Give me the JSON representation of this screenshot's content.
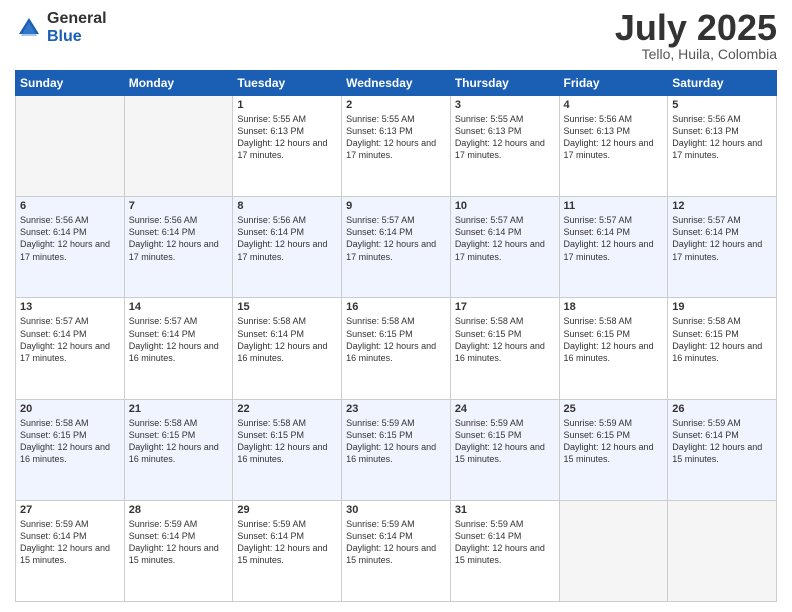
{
  "logo": {
    "general": "General",
    "blue": "Blue"
  },
  "header": {
    "title": "July 2025",
    "subtitle": "Tello, Huila, Colombia"
  },
  "weekdays": [
    "Sunday",
    "Monday",
    "Tuesday",
    "Wednesday",
    "Thursday",
    "Friday",
    "Saturday"
  ],
  "weeks": [
    [
      {
        "day": "",
        "info": ""
      },
      {
        "day": "",
        "info": ""
      },
      {
        "day": "1",
        "info": "Sunrise: 5:55 AM\nSunset: 6:13 PM\nDaylight: 12 hours and 17 minutes."
      },
      {
        "day": "2",
        "info": "Sunrise: 5:55 AM\nSunset: 6:13 PM\nDaylight: 12 hours and 17 minutes."
      },
      {
        "day": "3",
        "info": "Sunrise: 5:55 AM\nSunset: 6:13 PM\nDaylight: 12 hours and 17 minutes."
      },
      {
        "day": "4",
        "info": "Sunrise: 5:56 AM\nSunset: 6:13 PM\nDaylight: 12 hours and 17 minutes."
      },
      {
        "day": "5",
        "info": "Sunrise: 5:56 AM\nSunset: 6:13 PM\nDaylight: 12 hours and 17 minutes."
      }
    ],
    [
      {
        "day": "6",
        "info": "Sunrise: 5:56 AM\nSunset: 6:14 PM\nDaylight: 12 hours and 17 minutes."
      },
      {
        "day": "7",
        "info": "Sunrise: 5:56 AM\nSunset: 6:14 PM\nDaylight: 12 hours and 17 minutes."
      },
      {
        "day": "8",
        "info": "Sunrise: 5:56 AM\nSunset: 6:14 PM\nDaylight: 12 hours and 17 minutes."
      },
      {
        "day": "9",
        "info": "Sunrise: 5:57 AM\nSunset: 6:14 PM\nDaylight: 12 hours and 17 minutes."
      },
      {
        "day": "10",
        "info": "Sunrise: 5:57 AM\nSunset: 6:14 PM\nDaylight: 12 hours and 17 minutes."
      },
      {
        "day": "11",
        "info": "Sunrise: 5:57 AM\nSunset: 6:14 PM\nDaylight: 12 hours and 17 minutes."
      },
      {
        "day": "12",
        "info": "Sunrise: 5:57 AM\nSunset: 6:14 PM\nDaylight: 12 hours and 17 minutes."
      }
    ],
    [
      {
        "day": "13",
        "info": "Sunrise: 5:57 AM\nSunset: 6:14 PM\nDaylight: 12 hours and 17 minutes."
      },
      {
        "day": "14",
        "info": "Sunrise: 5:57 AM\nSunset: 6:14 PM\nDaylight: 12 hours and 16 minutes."
      },
      {
        "day": "15",
        "info": "Sunrise: 5:58 AM\nSunset: 6:14 PM\nDaylight: 12 hours and 16 minutes."
      },
      {
        "day": "16",
        "info": "Sunrise: 5:58 AM\nSunset: 6:15 PM\nDaylight: 12 hours and 16 minutes."
      },
      {
        "day": "17",
        "info": "Sunrise: 5:58 AM\nSunset: 6:15 PM\nDaylight: 12 hours and 16 minutes."
      },
      {
        "day": "18",
        "info": "Sunrise: 5:58 AM\nSunset: 6:15 PM\nDaylight: 12 hours and 16 minutes."
      },
      {
        "day": "19",
        "info": "Sunrise: 5:58 AM\nSunset: 6:15 PM\nDaylight: 12 hours and 16 minutes."
      }
    ],
    [
      {
        "day": "20",
        "info": "Sunrise: 5:58 AM\nSunset: 6:15 PM\nDaylight: 12 hours and 16 minutes."
      },
      {
        "day": "21",
        "info": "Sunrise: 5:58 AM\nSunset: 6:15 PM\nDaylight: 12 hours and 16 minutes."
      },
      {
        "day": "22",
        "info": "Sunrise: 5:58 AM\nSunset: 6:15 PM\nDaylight: 12 hours and 16 minutes."
      },
      {
        "day": "23",
        "info": "Sunrise: 5:59 AM\nSunset: 6:15 PM\nDaylight: 12 hours and 16 minutes."
      },
      {
        "day": "24",
        "info": "Sunrise: 5:59 AM\nSunset: 6:15 PM\nDaylight: 12 hours and 15 minutes."
      },
      {
        "day": "25",
        "info": "Sunrise: 5:59 AM\nSunset: 6:15 PM\nDaylight: 12 hours and 15 minutes."
      },
      {
        "day": "26",
        "info": "Sunrise: 5:59 AM\nSunset: 6:14 PM\nDaylight: 12 hours and 15 minutes."
      }
    ],
    [
      {
        "day": "27",
        "info": "Sunrise: 5:59 AM\nSunset: 6:14 PM\nDaylight: 12 hours and 15 minutes."
      },
      {
        "day": "28",
        "info": "Sunrise: 5:59 AM\nSunset: 6:14 PM\nDaylight: 12 hours and 15 minutes."
      },
      {
        "day": "29",
        "info": "Sunrise: 5:59 AM\nSunset: 6:14 PM\nDaylight: 12 hours and 15 minutes."
      },
      {
        "day": "30",
        "info": "Sunrise: 5:59 AM\nSunset: 6:14 PM\nDaylight: 12 hours and 15 minutes."
      },
      {
        "day": "31",
        "info": "Sunrise: 5:59 AM\nSunset: 6:14 PM\nDaylight: 12 hours and 15 minutes."
      },
      {
        "day": "",
        "info": ""
      },
      {
        "day": "",
        "info": ""
      }
    ]
  ]
}
